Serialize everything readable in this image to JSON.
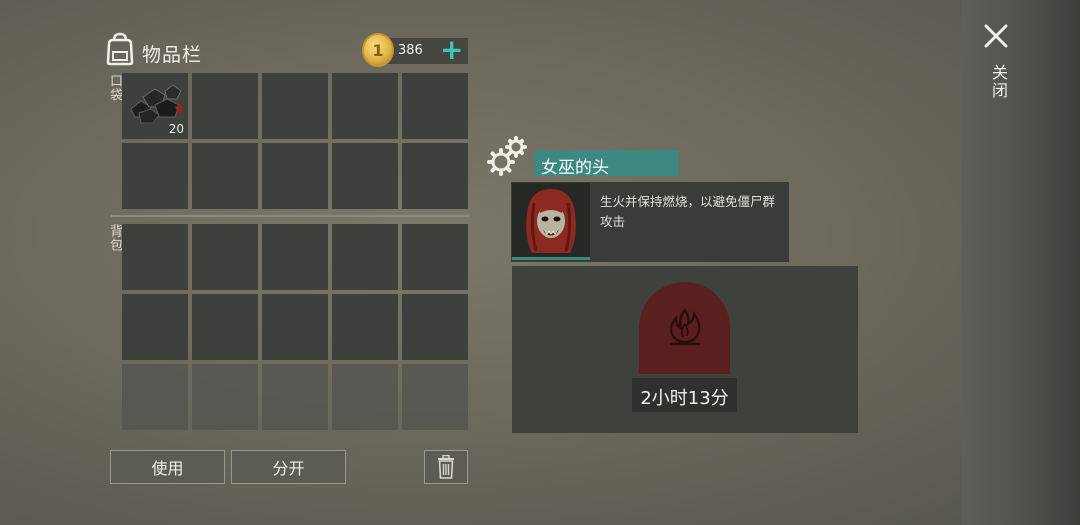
{
  "inventory": {
    "title": "物品栏",
    "coins": "386",
    "coin_symbol": "1",
    "add_symbol": "+",
    "pocket_label": "口袋",
    "bag_label": "背包",
    "pocket_item": {
      "name": "coal-pile",
      "count": "20"
    }
  },
  "buttons": {
    "use": "使用",
    "split": "分开"
  },
  "detail": {
    "title": "女巫的头",
    "description": "生火并保持燃烧，以避免僵尸群攻击",
    "timer": "2小时13分"
  },
  "close": {
    "label": "关闭"
  },
  "colors": {
    "accent": "#3d8880",
    "plus": "#3fc5b4",
    "fire_arch": "#5a1f1f",
    "coin": "#e3b444"
  }
}
